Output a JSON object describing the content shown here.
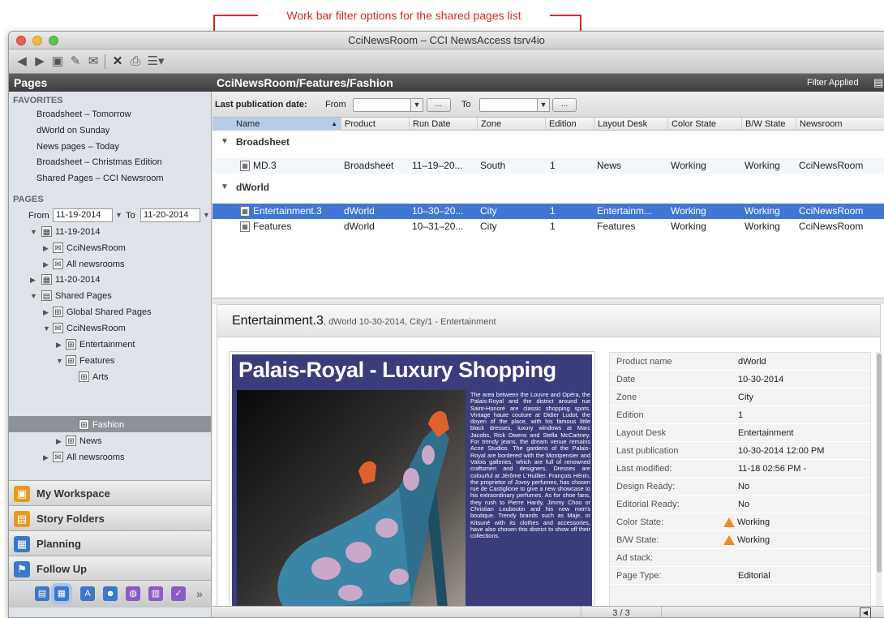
{
  "callout": {
    "text": "Work bar filter options for the shared pages list",
    "color": "#d42a2a"
  },
  "window": {
    "title": "CciNewsRoom – CCI NewsAccess tsrv4io"
  },
  "header": {
    "pages_title": "Pages",
    "path": "CciNewsRoom/Features/Fashion",
    "filter_status": "Filter Applied"
  },
  "sidebar": {
    "favorites_label": "FAVORITES",
    "favorites": [
      "Broadsheet – Tomorrow",
      "dWorld on Sunday",
      "News pages – Today",
      "Broadsheet – Christmas Edition",
      "Shared Pages – CCI Newsroom"
    ],
    "pages_label": "PAGES",
    "from_label": "From",
    "from_value": "11-19-2014",
    "to_label": "To",
    "to_value": "11-20-2014",
    "tree": [
      "11-19-2014",
      "CciNewsRoom",
      "All newsrooms",
      "11-20-2014",
      "Shared Pages",
      "Global Shared Pages",
      "CciNewsRoom",
      "Entertainment",
      "Features",
      "Arts",
      "Fashion",
      "News",
      "All newsrooms"
    ],
    "nav": [
      "My Workspace",
      "Story Folders",
      "Planning",
      "Follow Up"
    ]
  },
  "workbar": {
    "label": "Last publication date:",
    "from_label": "From",
    "to_label": "To",
    "browse": "..."
  },
  "columns": [
    "Name",
    "Product",
    "Run Date",
    "Zone",
    "Edition",
    "Layout Desk",
    "Color State",
    "B/W State",
    "Newsroom"
  ],
  "groups": [
    {
      "label": "Broadsheet",
      "rows": [
        [
          "MD.3",
          "Broadsheet",
          "11–19–20...",
          "South",
          "1",
          "News",
          "Working",
          "Working",
          "CciNewsRoom"
        ]
      ]
    },
    {
      "label": "dWorld",
      "rows": [
        [
          "Entertainment.3",
          "dWorld",
          "10–30–20...",
          "City",
          "1",
          "Entertainm...",
          "Working",
          "Working",
          "CciNewsRoom"
        ],
        [
          "Features",
          "dWorld",
          "10–31–20...",
          "City",
          "1",
          "Features",
          "Working",
          "Working",
          "CciNewsRoom"
        ]
      ]
    }
  ],
  "detail": {
    "title": "Entertainment.3",
    "subtitle": ", dWorld 10-30-2014, City/1 - Entertainment",
    "preview_headline": "Palais-Royal - Luxury Shopping",
    "preview_text": "The area between the Louvre and Opéra, the Palais-Royal and the district around rue Saint-Honoré are classic shopping spots. Vintage haute couture at Didier Ludot, the doyen of the place, with his famous little black dresses, luxury windows at Marc Jacobs, Rick Owens and Stella McCartney. For trendy jeans, the dream venue remains Acne Studios. The gardens of the Palais-Royal are bordered with the Montpensier and Valois galleries, which are full of renowned craftsmen and designers. Dresses are colourful at Jérôme L'Huillier. François Hénin, the proprietor of Jovoy perfumes, has chosen rue de Castiglione to give a new showcase to his extraordinary perfumes. As for shoe fans, they rush to Pierre Hardy, Jimmy Choo or Christian Louboutin and his new men's boutique. Trendy brands such as Maje, or Kitsuné with its clothes and accessories, have also chosen this district to show off their collections.",
    "properties": [
      {
        "label": "Product name",
        "value": "dWorld"
      },
      {
        "label": "Date",
        "value": "10-30-2014"
      },
      {
        "label": "Zone",
        "value": "City"
      },
      {
        "label": "Edition",
        "value": "1"
      },
      {
        "label": "Layout Desk",
        "value": "Entertainment"
      },
      {
        "label": "Last publication",
        "value": "10-30-2014 12:00 PM"
      },
      {
        "label": "Last modified:",
        "value": "11-18 02:56 PM -"
      },
      {
        "label": "Design Ready:",
        "value": "No"
      },
      {
        "label": "Editorial Ready:",
        "value": "No"
      },
      {
        "label": "Color State:",
        "value": "Working"
      },
      {
        "label": "B/W State:",
        "value": "Working"
      },
      {
        "label": "Ad stack:",
        "value": ""
      },
      {
        "label": "Page Type:",
        "value": "Editorial"
      }
    ]
  },
  "status": {
    "page_count": "3 / 3"
  },
  "colors": {
    "selection": "#3f77d3",
    "header": "#4a4a4a",
    "warning": "#f08a24"
  }
}
